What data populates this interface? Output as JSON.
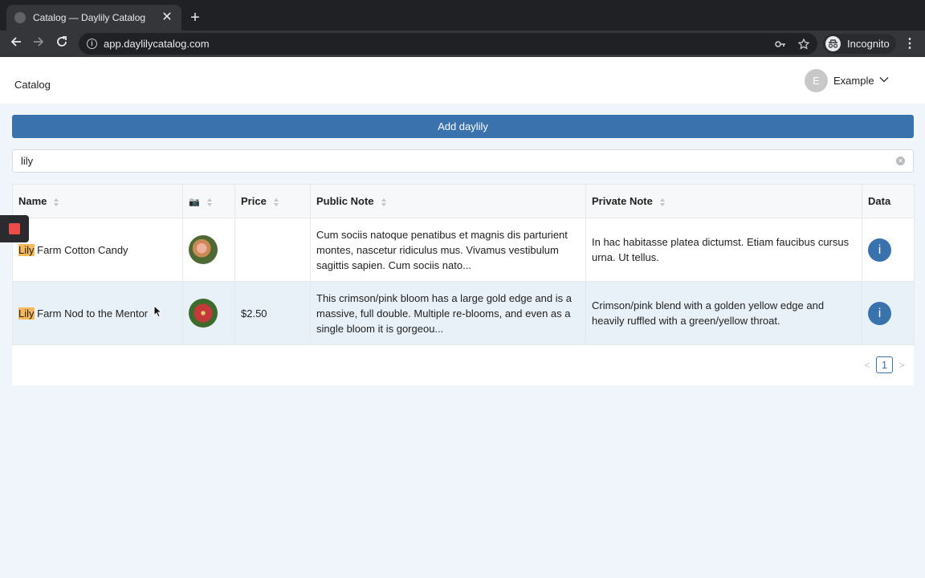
{
  "browser": {
    "tab_title": "Catalog — Daylily Catalog",
    "close_glyph": "✕",
    "new_tab_glyph": "+",
    "url": "app.daylilycatalog.com",
    "incognito_label": "Incognito",
    "icons": [
      "globe-icon",
      "back-icon",
      "forward-icon",
      "reload-icon",
      "info-icon",
      "key-icon",
      "star-icon",
      "incognito-icon",
      "menu-icon"
    ]
  },
  "header": {
    "nav_item": "Catalog",
    "user_initial": "E",
    "user_name": "Example"
  },
  "toolbar": {
    "add_button_label": "Add daylily"
  },
  "search": {
    "value": "lily"
  },
  "table": {
    "columns": [
      "Name",
      "📷",
      "Price",
      "Public Note",
      "Private Note",
      "Data"
    ],
    "rows": [
      {
        "name_highlight": "Lily",
        "name_rest": " Farm Cotton Candy",
        "price": "",
        "public_note": "Cum sociis natoque penatibus et magnis dis parturient montes, nascetur ridiculus mus. Vivamus vestibulum sagittis sapien. Cum sociis nato...",
        "private_note": "In hac habitasse platea dictumst. Etiam faucibus cursus urna. Ut tellus.",
        "data_glyph": "i"
      },
      {
        "name_highlight": "Lily",
        "name_rest": " Farm Nod to the Mentor",
        "price": "$2.50",
        "public_note": "This crimson/pink bloom has a large gold edge and is a massive, full double. Multiple re-blooms, and even as a single bloom it is gorgeou...",
        "private_note": "Crimson/pink blend with a golden yellow edge and heavily ruffled with a green/yellow throat.",
        "data_glyph": "i"
      }
    ]
  },
  "pagination": {
    "current_page": "1",
    "prev_glyph": "<",
    "next_glyph": ">"
  },
  "colors": {
    "primary": "#3a72ae",
    "highlight": "#f7b85a",
    "record_button": "#ee4b4b"
  }
}
